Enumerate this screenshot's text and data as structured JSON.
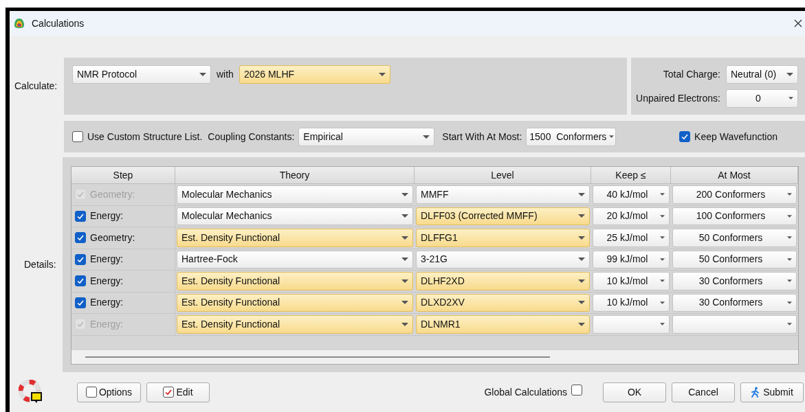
{
  "window": {
    "title": "Calculations"
  },
  "calculate": {
    "label": "Calculate:",
    "method": {
      "value": "NMR Protocol",
      "highlighted": false
    },
    "with_label": "with",
    "model": {
      "value": "2026 MLHF",
      "highlighted": true
    }
  },
  "charge": {
    "total_charge": {
      "label": "Total Charge:",
      "value": "Neutral (0)"
    },
    "unpaired": {
      "label": "Unpaired Electrons:",
      "value": "0"
    }
  },
  "options_row": {
    "custom_list": {
      "label": "Use Custom Structure List.",
      "checked": false
    },
    "coupling": {
      "label": "Coupling Constants:",
      "value": "Empirical"
    },
    "start_with": {
      "label": "Start With At Most:",
      "value": "1500  Conformers"
    },
    "keep_wavefunction": {
      "label": "Keep Wavefunction",
      "checked": true
    }
  },
  "details": {
    "label": "Details:",
    "columns": [
      "Step",
      "Theory",
      "Level",
      "Keep ≤",
      "At Most"
    ],
    "rows": [
      {
        "step": "Geometry:",
        "checked": true,
        "disabled": true,
        "theory": {
          "value": "Molecular Mechanics",
          "highlighted": false
        },
        "level": {
          "value": "MMFF",
          "highlighted": false
        },
        "keep": "40 kJ/mol",
        "at_most": "200 Conformers"
      },
      {
        "step": "Energy:",
        "checked": true,
        "disabled": false,
        "theory": {
          "value": "Molecular Mechanics",
          "highlighted": false
        },
        "level": {
          "value": "DLFF03 (Corrected MMFF)",
          "highlighted": true
        },
        "keep": "20 kJ/mol",
        "at_most": "100 Conformers"
      },
      {
        "step": "Geometry:",
        "checked": true,
        "disabled": false,
        "theory": {
          "value": "Est. Density Functional",
          "highlighted": true
        },
        "level": {
          "value": "DLFFG1",
          "highlighted": true
        },
        "keep": "25 kJ/mol",
        "at_most": "50 Conformers"
      },
      {
        "step": "Energy:",
        "checked": true,
        "disabled": false,
        "theory": {
          "value": "Hartree-Fock",
          "highlighted": false
        },
        "level": {
          "value": "3-21G",
          "highlighted": false
        },
        "keep": "99 kJ/mol",
        "at_most": "50 Conformers"
      },
      {
        "step": "Energy:",
        "checked": true,
        "disabled": false,
        "theory": {
          "value": "Est. Density Functional",
          "highlighted": true
        },
        "level": {
          "value": "DLHF2XD",
          "highlighted": true
        },
        "keep": "10 kJ/mol",
        "at_most": "30 Conformers"
      },
      {
        "step": "Energy:",
        "checked": true,
        "disabled": false,
        "theory": {
          "value": "Est. Density Functional",
          "highlighted": true
        },
        "level": {
          "value": "DLXD2XV",
          "highlighted": true
        },
        "keep": "10 kJ/mol",
        "at_most": "30 Conformers"
      },
      {
        "step": "Energy:",
        "checked": true,
        "disabled": true,
        "theory": {
          "value": "Est. Density Functional",
          "highlighted": true
        },
        "level": {
          "value": "DLNMR1",
          "highlighted": true
        }
      }
    ]
  },
  "footer": {
    "options": {
      "label": "Options",
      "checked": false
    },
    "edit": {
      "label": "Edit",
      "checked": true
    },
    "global_calculations": {
      "label": "Global Calculations",
      "checked": false
    },
    "buttons": [
      {
        "label": "OK",
        "kind": "plain"
      },
      {
        "label": "Cancel",
        "kind": "plain"
      },
      {
        "label": "Submit",
        "kind": "submit"
      }
    ]
  }
}
